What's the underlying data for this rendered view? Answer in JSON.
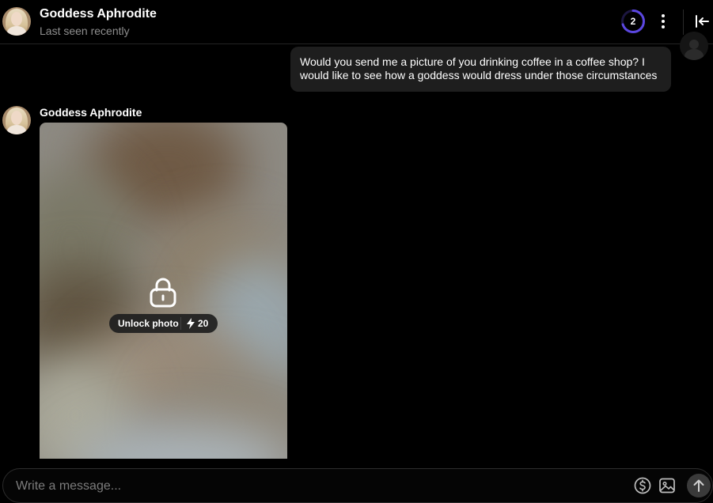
{
  "header": {
    "contact_name": "Goddess Aphrodite",
    "status": "Last seen recently",
    "counter_value": "2",
    "counter_progress": 0.7,
    "accent_color": "#5b47e0"
  },
  "messages": [
    {
      "direction": "outgoing",
      "text": "Would you send me a picture of you drinking coffee in a coffee shop? I would like to see how a goddess would dress under those circumstances"
    },
    {
      "direction": "incoming",
      "sender": "Goddess Aphrodite",
      "type": "locked-photo",
      "unlock_label": "Unlock photo",
      "price": "20",
      "icons": [
        "lock-icon",
        "bolt-icon"
      ]
    }
  ],
  "composer": {
    "placeholder": "Write a message...",
    "icons": [
      "dollar-icon",
      "image-icon",
      "arrow-up-icon"
    ]
  },
  "header_icons": [
    "more-vertical-icon",
    "collapse-panel-icon"
  ]
}
